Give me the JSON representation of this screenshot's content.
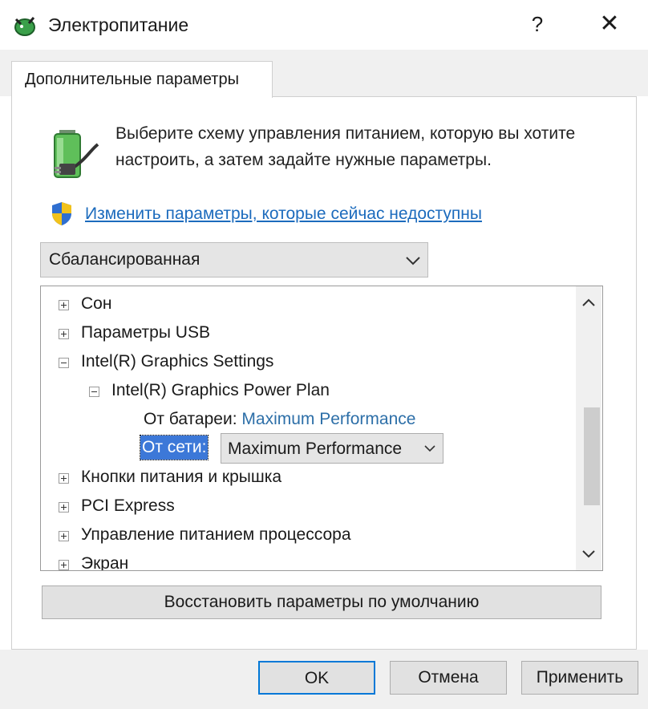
{
  "window": {
    "title": "Электропитание",
    "help_label": "?",
    "close_label": "✕"
  },
  "tab": {
    "label": "Дополнительные параметры"
  },
  "description": {
    "text": "Выберите схему управления питанием, которую вы хотите настроить, а затем задайте нужные параметры."
  },
  "change_link": {
    "label": "Изменить параметры, которые сейчас недоступны"
  },
  "plan_combo": {
    "value": "Сбалансированная"
  },
  "tree": {
    "sleep": "Сон",
    "usb": "Параметры USB",
    "intel_graphics": "Intel(R) Graphics Settings",
    "intel_power_plan": "Intel(R) Graphics Power Plan",
    "on_battery_label": "От батареи:",
    "on_battery_value": "Maximum Performance",
    "plugged_in_label": "От сети:",
    "plugged_in_value": "Maximum Performance",
    "power_buttons": "Кнопки питания и крышка",
    "pci_express": "PCI Express",
    "processor": "Управление питанием процессора",
    "display": "Экран"
  },
  "restore_button": {
    "label": "Восстановить параметры по умолчанию"
  },
  "footer": {
    "ok_label": "OK",
    "cancel_label": "Отмена",
    "apply_label": "Применить"
  },
  "colors": {
    "accent": "#0078d7",
    "link": "#1c6bbd",
    "selection": "#3c78d8",
    "value_blue": "#2d6fa8"
  },
  "icons": {
    "app": "power-options-icon",
    "battery": "battery-plug-icon",
    "shield": "uac-shield-icon"
  }
}
